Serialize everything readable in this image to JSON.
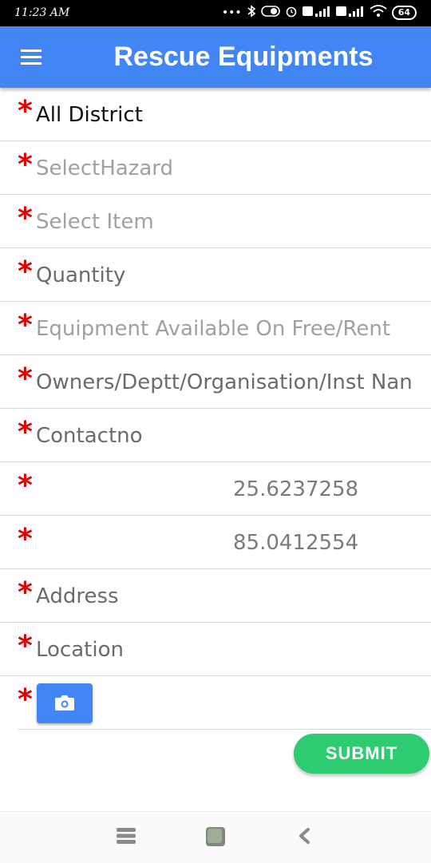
{
  "status_bar": {
    "time": "11:23 AM",
    "battery": "64",
    "icons": [
      "dots-icon",
      "bluetooth-icon",
      "toggle-icon",
      "alarm-icon",
      "volte-signal-icon",
      "volte-signal-icon",
      "wifi-icon",
      "battery-icon"
    ]
  },
  "toolbar": {
    "title": "Rescue Equipments",
    "menu_icon": "hamburger-menu-icon"
  },
  "form": {
    "required_marker": "*",
    "fields": [
      {
        "value": "All District"
      },
      {
        "placeholder": "SelectHazard"
      },
      {
        "placeholder": "Select Item"
      },
      {
        "placeholder": "Quantity"
      },
      {
        "placeholder": "Equipment Available On Free/Rent"
      },
      {
        "placeholder": "Owners/Deptt/Organisation/Inst Nan"
      },
      {
        "placeholder": "Contactno"
      },
      {
        "value": "25.6237258"
      },
      {
        "value": "85.0412554"
      },
      {
        "placeholder": "Address"
      },
      {
        "placeholder": "Location"
      }
    ],
    "camera_icon": "camera-icon"
  },
  "submit_label": "SUBMIT",
  "nav_bar": {
    "icons": [
      "recent-apps-icon",
      "home-icon",
      "back-icon"
    ]
  },
  "colors": {
    "primary": "#4285f4",
    "submit": "#2ecc71",
    "required": "#e00000"
  }
}
